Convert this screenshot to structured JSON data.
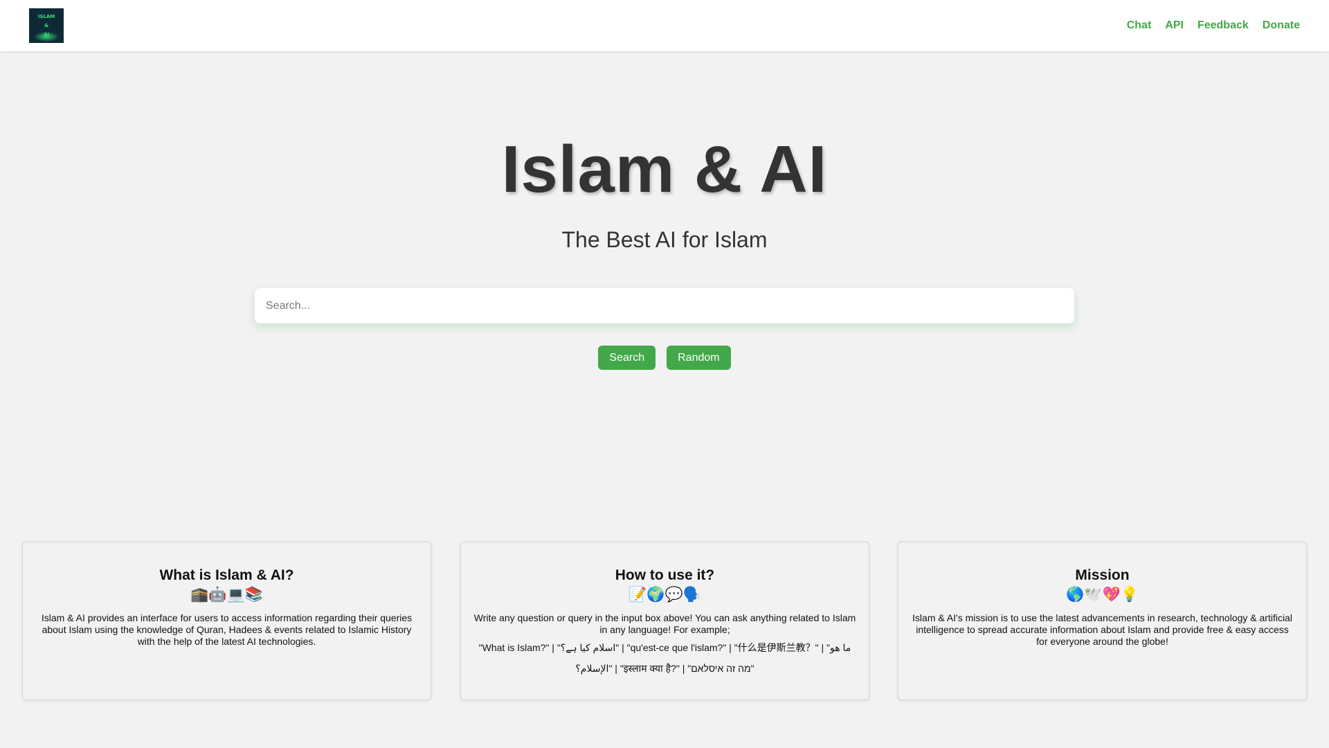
{
  "header": {
    "logo_text": "ISLAM\n&\nAI",
    "nav": [
      "Chat",
      "API",
      "Feedback",
      "Donate"
    ]
  },
  "hero": {
    "title": "Islam & AI",
    "subtitle": "The Best AI for Islam"
  },
  "search": {
    "placeholder": "Search...",
    "value": "",
    "search_label": "Search",
    "random_label": "Random"
  },
  "cards": [
    {
      "title": "What is Islam & AI?",
      "emoji": "🕋🤖💻📚",
      "text": "Islam & AI provides an interface for users to access information regarding their queries about Islam using the knowledge of Quran, Hadees & events related to Islamic History with the help of the latest AI technologies."
    },
    {
      "title": "How to use it?",
      "emoji": "📝🌍💬🗣️",
      "text": "Write any question or query in the input box above! You can ask anything related to Islam in any language! For example;",
      "examples": "\"What is Islam?\" | \"اسلام کیا ہے؟\" | \"qu'est-ce que l'islam?\" | \"什么是伊斯兰教？\" | \"ما هو الإسلام؟\" | \"इस्लाम क्या है?\" | \"מה זה איסלאם\""
    },
    {
      "title": "Mission",
      "emoji": "🌎🕊️💖💡",
      "text": "Islam & AI's mission is to use the latest advancements in research, technology & artificial intelligence to spread accurate information about Islam and provide free & easy access for everyone around the globe!"
    }
  ],
  "colors": {
    "accent": "#43a84a",
    "nav_link": "#3fa845",
    "background": "#f2f2f2"
  }
}
